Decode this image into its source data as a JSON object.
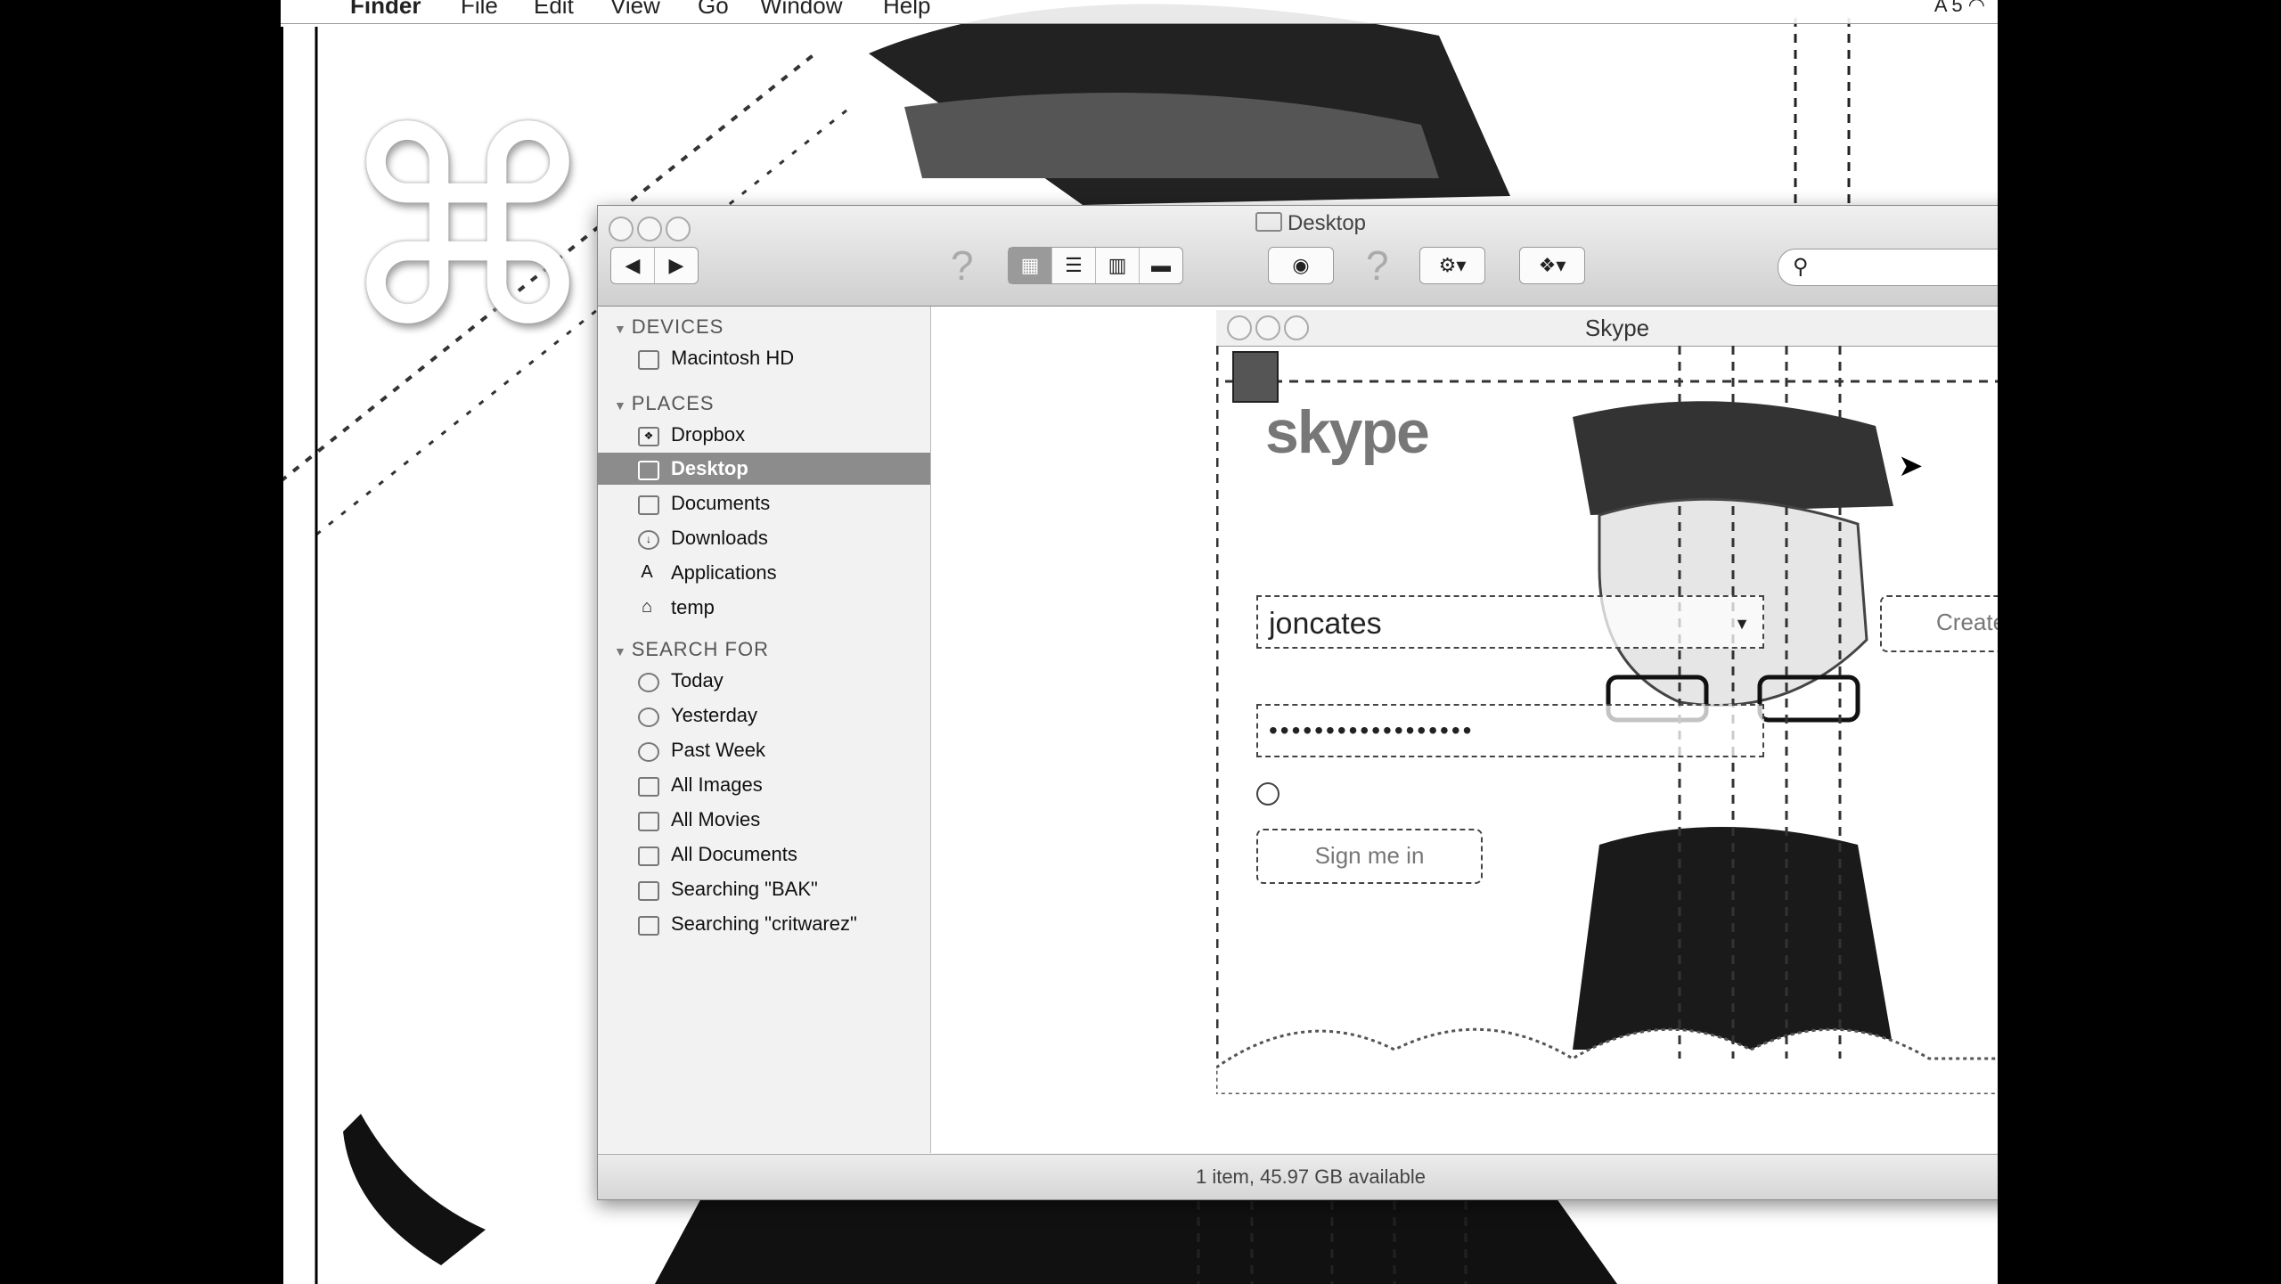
{
  "menubar": {
    "app_name": "Finder",
    "items": [
      "File",
      "Edit",
      "View",
      "Go",
      "Window",
      "Help"
    ],
    "tray_text": "A 5"
  },
  "command_logo": "⌘",
  "finder": {
    "title": "Desktop",
    "search_placeholder": "",
    "sidebar": {
      "devices_header": "DEVICES",
      "devices": [
        "Macintosh HD"
      ],
      "places_header": "PLACES",
      "places": [
        "Dropbox",
        "Desktop",
        "Documents",
        "Downloads",
        "Applications",
        "temp"
      ],
      "selected": "Desktop",
      "search_header": "SEARCH FOR",
      "searches": [
        "Today",
        "Yesterday",
        "Past Week",
        "All Images",
        "All Movies",
        "All Documents",
        "Searching \"BAK\"",
        "Searching \"critwarez\""
      ]
    },
    "status": "1 item, 45.97 GB available"
  },
  "skype": {
    "title": "Skype",
    "logo": "skype",
    "username": "joncates",
    "password_mask": "••••••••••••••••••",
    "create_account_label": "Create a new account",
    "sign_in_label": "Sign me in"
  }
}
